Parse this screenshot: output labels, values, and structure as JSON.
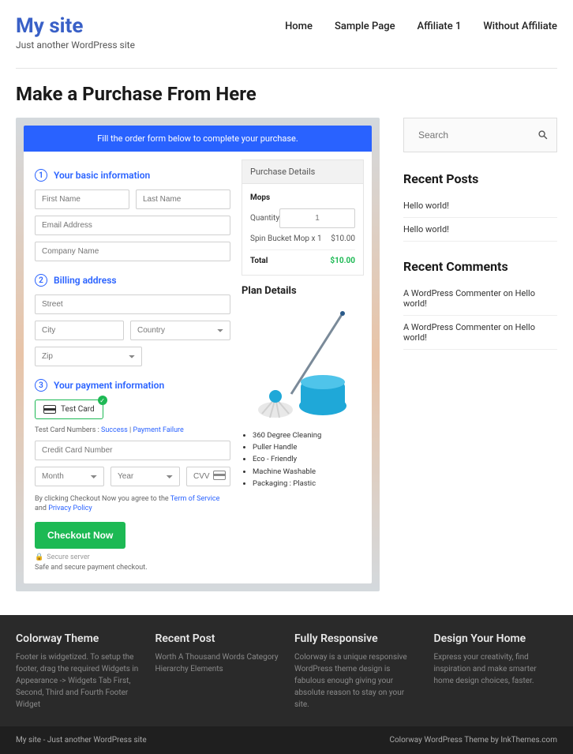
{
  "header": {
    "site_title": "My site",
    "tagline": "Just another WordPress site",
    "nav": [
      "Home",
      "Sample Page",
      "Affiliate 1",
      "Without Affiliate"
    ]
  },
  "page": {
    "title": "Make a Purchase From Here"
  },
  "order": {
    "banner": "Fill the order form below to complete your purchase.",
    "sec1": "Your basic information",
    "first_name": "First Name",
    "last_name": "Last Name",
    "email": "Email Address",
    "company": "Company Name",
    "sec2": "Billing address",
    "street": "Street",
    "city": "City",
    "country": "Country",
    "zip": "Zip",
    "sec3": "Your payment information",
    "test_card": "Test Card",
    "test_note_pre": "Test Card Numbers : ",
    "test_note_link1": "Success",
    "test_note_sep": " | ",
    "test_note_link2": "Payment Failure",
    "cc": "Credit Card Number",
    "month": "Month",
    "year": "Year",
    "cvv": "CVV",
    "agree_pre": "By clicking Checkout Now you agree to the ",
    "tos": "Term of Service",
    "and": " and ",
    "pp": "Privacy Policy",
    "checkout": "Checkout Now",
    "secure": "Secure server",
    "safe": "Safe and secure payment checkout."
  },
  "purchase": {
    "head": "Purchase Details",
    "item": "Mops",
    "qty_label": "Quantity",
    "qty": "1",
    "line": "Spin Bucket Mop x 1",
    "line_price": "$10.00",
    "total": "Total",
    "total_price": "$10.00",
    "plan_title": "Plan Details",
    "bullets": [
      "360 Degree Cleaning",
      "Puller Handle",
      "Eco - Friendly",
      "Machine Washable",
      "Packaging : Plastic"
    ]
  },
  "sidebar": {
    "search": "Search",
    "recent_posts_title": "Recent Posts",
    "recent_posts": [
      "Hello world!",
      "Hello world!"
    ],
    "recent_comments_title": "Recent Comments",
    "recent_comments": [
      "A WordPress Commenter on Hello world!",
      "A WordPress Commenter on Hello world!"
    ]
  },
  "footer": {
    "cols": [
      {
        "title": "Colorway Theme",
        "body": "Footer is widgetized. To setup the footer, drag the required Widgets in Appearance -> Widgets Tab First, Second, Third and Fourth Footer Widget"
      },
      {
        "title": "Recent Post",
        "body": "Worth A Thousand Words Category Hierarchy Elements"
      },
      {
        "title": "Fully Responsive",
        "body": "Colorway is a unique responsive WordPress theme design is fabulous enough giving your absolute reason to stay on your site."
      },
      {
        "title": "Design Your Home",
        "body": "Express your creativity, find inspiration and make smarter home design choices, faster."
      }
    ],
    "bar_left": "My site - Just another WordPress site",
    "bar_right": "Colorway WordPress Theme by InkThemes.com"
  }
}
